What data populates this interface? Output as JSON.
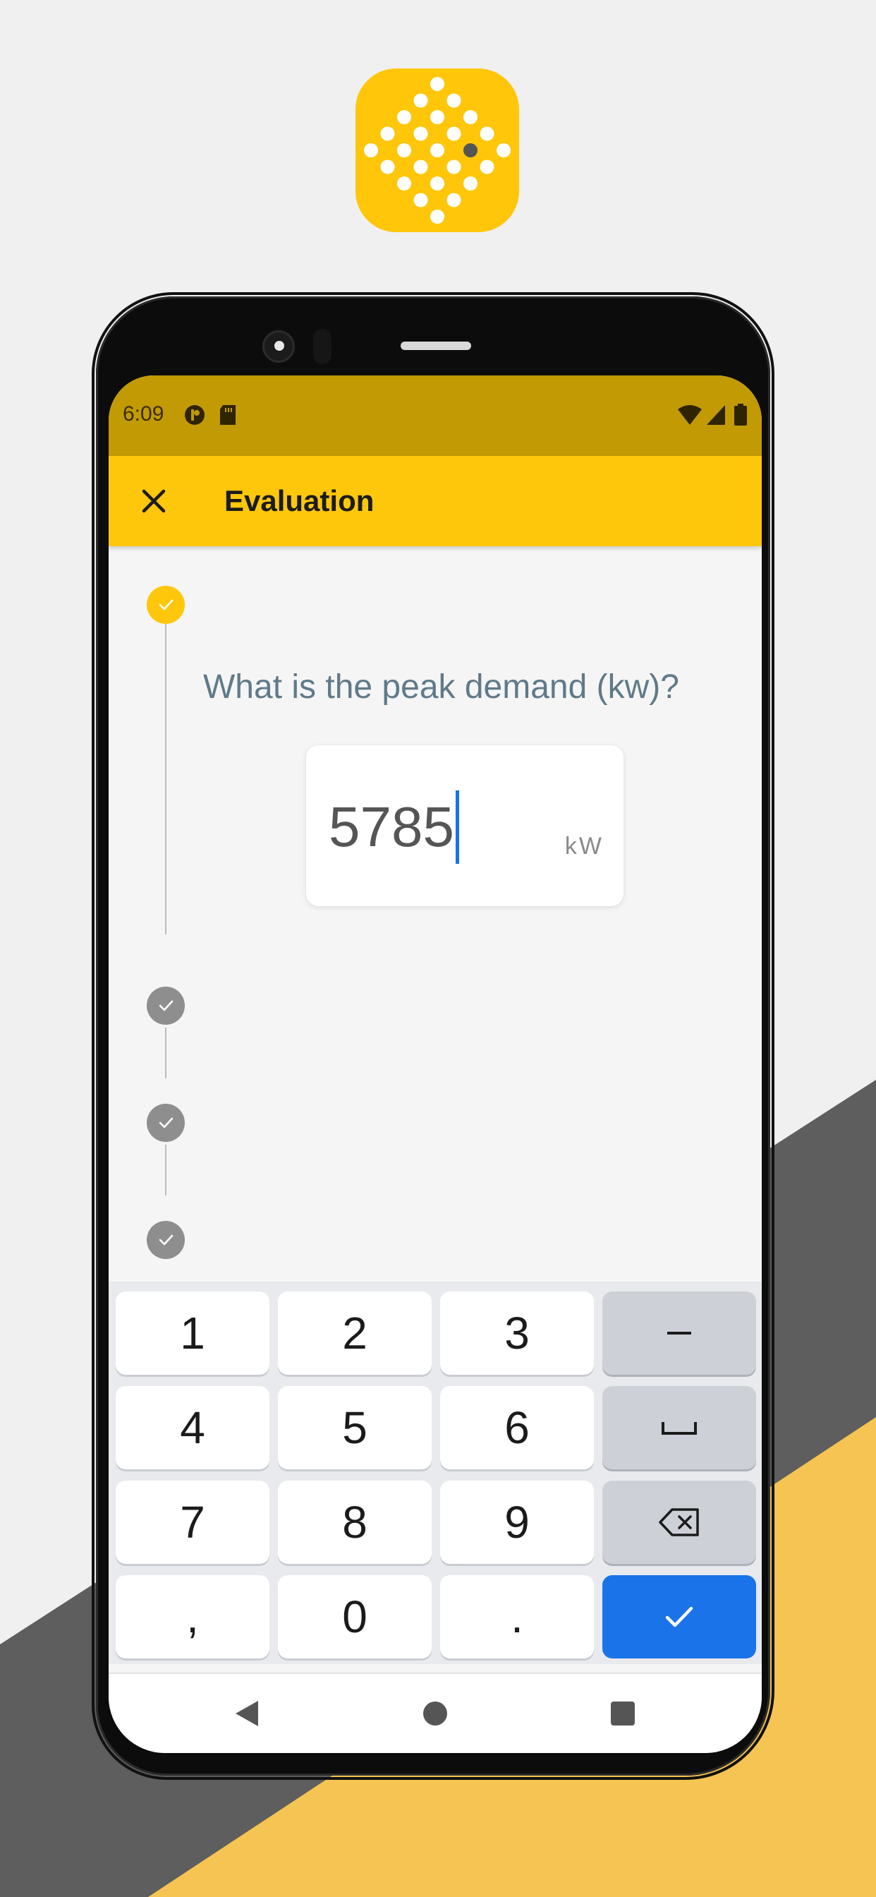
{
  "colors": {
    "brand_yellow": "#ffc70b",
    "status_bar": "#c29a04",
    "question_text": "#5f7a89",
    "accent_blue": "#1a73e8",
    "step_done": "#8e8e8e",
    "bg_dark_band": "#5e5e5e",
    "bg_yellow_band": "#f6c452"
  },
  "status_bar": {
    "time": "6:09",
    "left_icons": [
      "notification-app-icon",
      "sd-card-icon"
    ],
    "right_icons": [
      "wifi-icon",
      "signal-icon",
      "battery-icon"
    ]
  },
  "app_bar": {
    "close_icon": "close-icon",
    "title": "Evaluation"
  },
  "stepper": {
    "steps": [
      {
        "state": "active"
      },
      {
        "state": "done"
      },
      {
        "state": "done"
      },
      {
        "state": "done"
      }
    ]
  },
  "question": {
    "text": "What is the peak demand (kw)?",
    "value": "5785",
    "unit": "kW"
  },
  "keyboard": {
    "keys": [
      {
        "label": "1",
        "type": "digit"
      },
      {
        "label": "2",
        "type": "digit"
      },
      {
        "label": "3",
        "type": "digit"
      },
      {
        "label": "–",
        "type": "fn",
        "icon": "minus-icon"
      },
      {
        "label": "4",
        "type": "digit"
      },
      {
        "label": "5",
        "type": "digit"
      },
      {
        "label": "6",
        "type": "digit"
      },
      {
        "label": "␣",
        "type": "fn",
        "icon": "space-icon"
      },
      {
        "label": "7",
        "type": "digit"
      },
      {
        "label": "8",
        "type": "digit"
      },
      {
        "label": "9",
        "type": "digit"
      },
      {
        "label": "⌫",
        "type": "fn",
        "icon": "backspace-icon"
      },
      {
        "label": ",",
        "type": "digit"
      },
      {
        "label": "0",
        "type": "digit"
      },
      {
        "label": ".",
        "type": "digit"
      },
      {
        "label": "✓",
        "type": "enter",
        "icon": "check-icon"
      }
    ]
  },
  "nav_bar": {
    "buttons": [
      "back-icon",
      "home-icon",
      "recents-icon"
    ]
  }
}
